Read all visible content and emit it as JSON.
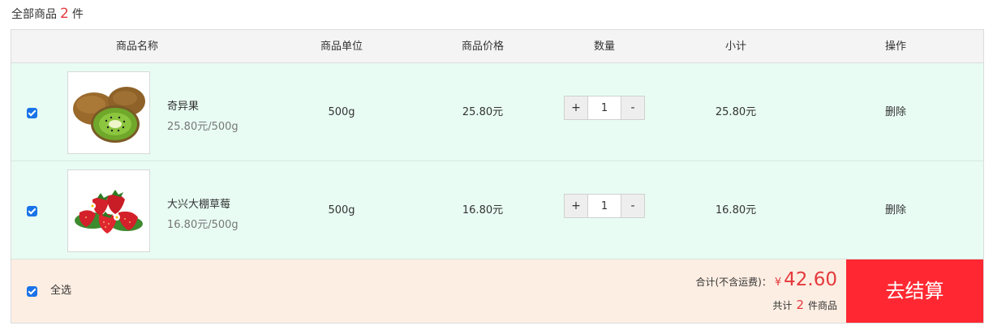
{
  "summary": {
    "label_prefix": "全部商品",
    "count": "2",
    "label_suffix": "件"
  },
  "columns": {
    "name": "商品名称",
    "unit": "商品单位",
    "price": "商品价格",
    "quantity": "数量",
    "subtotal": "小计",
    "action": "操作"
  },
  "items": [
    {
      "checked": true,
      "name": "奇异果",
      "spec": "25.80元/500g",
      "unit": "500g",
      "price": "25.80元",
      "quantity": "1",
      "subtotal": "25.80元",
      "action": "删除",
      "plus_label": "+",
      "minus_label": "-",
      "image_icon": "kiwi-image"
    },
    {
      "checked": true,
      "name": "大兴大棚草莓",
      "spec": "16.80元/500g",
      "unit": "500g",
      "price": "16.80元",
      "quantity": "1",
      "subtotal": "16.80元",
      "action": "删除",
      "plus_label": "+",
      "minus_label": "-",
      "image_icon": "strawberry-image"
    }
  ],
  "footer": {
    "select_all_checked": true,
    "select_all_label": "全选",
    "total_label": "合计(不含运费)：",
    "currency": "¥",
    "total_amount": "42.60",
    "count_prefix": "共计",
    "count": "2",
    "count_suffix": "件商品",
    "checkout_label": "去结算"
  },
  "colors": {
    "accent_red": "#e4393c",
    "checkout_bg": "#ff2832",
    "row_bg": "#e8fcf4",
    "footer_bg": "#fdeee3",
    "header_bg": "#f4f4f4",
    "checkbox": "#1a73e8"
  }
}
